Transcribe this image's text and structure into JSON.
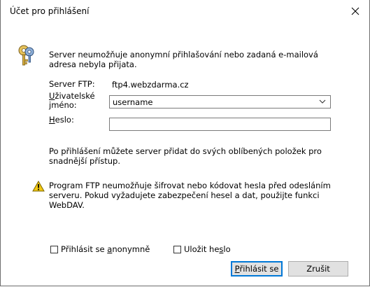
{
  "dialog": {
    "title": "Účet pro přihlášení",
    "close_glyph": "✕"
  },
  "info": {
    "icon": "keys-icon",
    "message": "Server neumožňuje anonymní přihlašování nebo zadaná e-mailová adresa nebyla přijata."
  },
  "form": {
    "server_label": "Server FTP:",
    "server_value": "ftp4.webzdarma.cz",
    "username_label_u": "U",
    "username_label_rest1": "živatelské",
    "username_label_rest2": "jméno:",
    "username_value": "username",
    "password_label_u": "H",
    "password_label_rest": "eslo:",
    "password_value": ""
  },
  "hint": {
    "message": "Po přihlášení můžete server přidat do svých oblíbených položek pro snadnější přístup."
  },
  "warning": {
    "icon": "warning-icon",
    "message": "Program FTP neumožňuje šifrovat nebo kódovat hesla před odesláním serveru. Pokud vyžadujete zabezpečení hesel a dat, použijte funkci WebDAV."
  },
  "options": {
    "anonymous_pre": "Přihlásit se ",
    "anonymous_u": "a",
    "anonymous_post": "nonymně",
    "anonymous_checked": false,
    "save_pre": "Uložit he",
    "save_u": "s",
    "save_post": "lo",
    "save_checked": false
  },
  "buttons": {
    "login_u": "P",
    "login_rest": "řihlásit se",
    "cancel": "Zrušit"
  },
  "colors": {
    "accent": "#0078d7",
    "warning": "#f2c811"
  }
}
